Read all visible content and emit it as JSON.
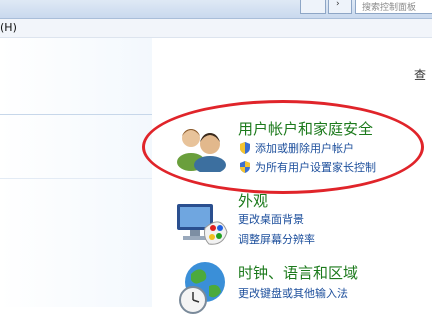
{
  "window": {
    "search_placeholder": "搜索控制面板",
    "menu_help": "(H)",
    "view_by_fragment": "查"
  },
  "categories": [
    {
      "title": "用户帐户和家庭安全",
      "icon": "users-icon",
      "links": [
        "添加或删除用户帐户",
        "为所有用户设置家长控制"
      ]
    },
    {
      "title": "外观",
      "icon": "appearance-icon",
      "links": [
        "更改桌面背景",
        "调整屏幕分辨率"
      ]
    },
    {
      "title": "时钟、语言和区域",
      "icon": "clock-globe-icon",
      "links": [
        "更改键盘或其他输入法"
      ]
    }
  ],
  "colors": {
    "category_title": "#1c7a1c",
    "link": "#1d4f9c",
    "highlight": "#e0242a"
  }
}
